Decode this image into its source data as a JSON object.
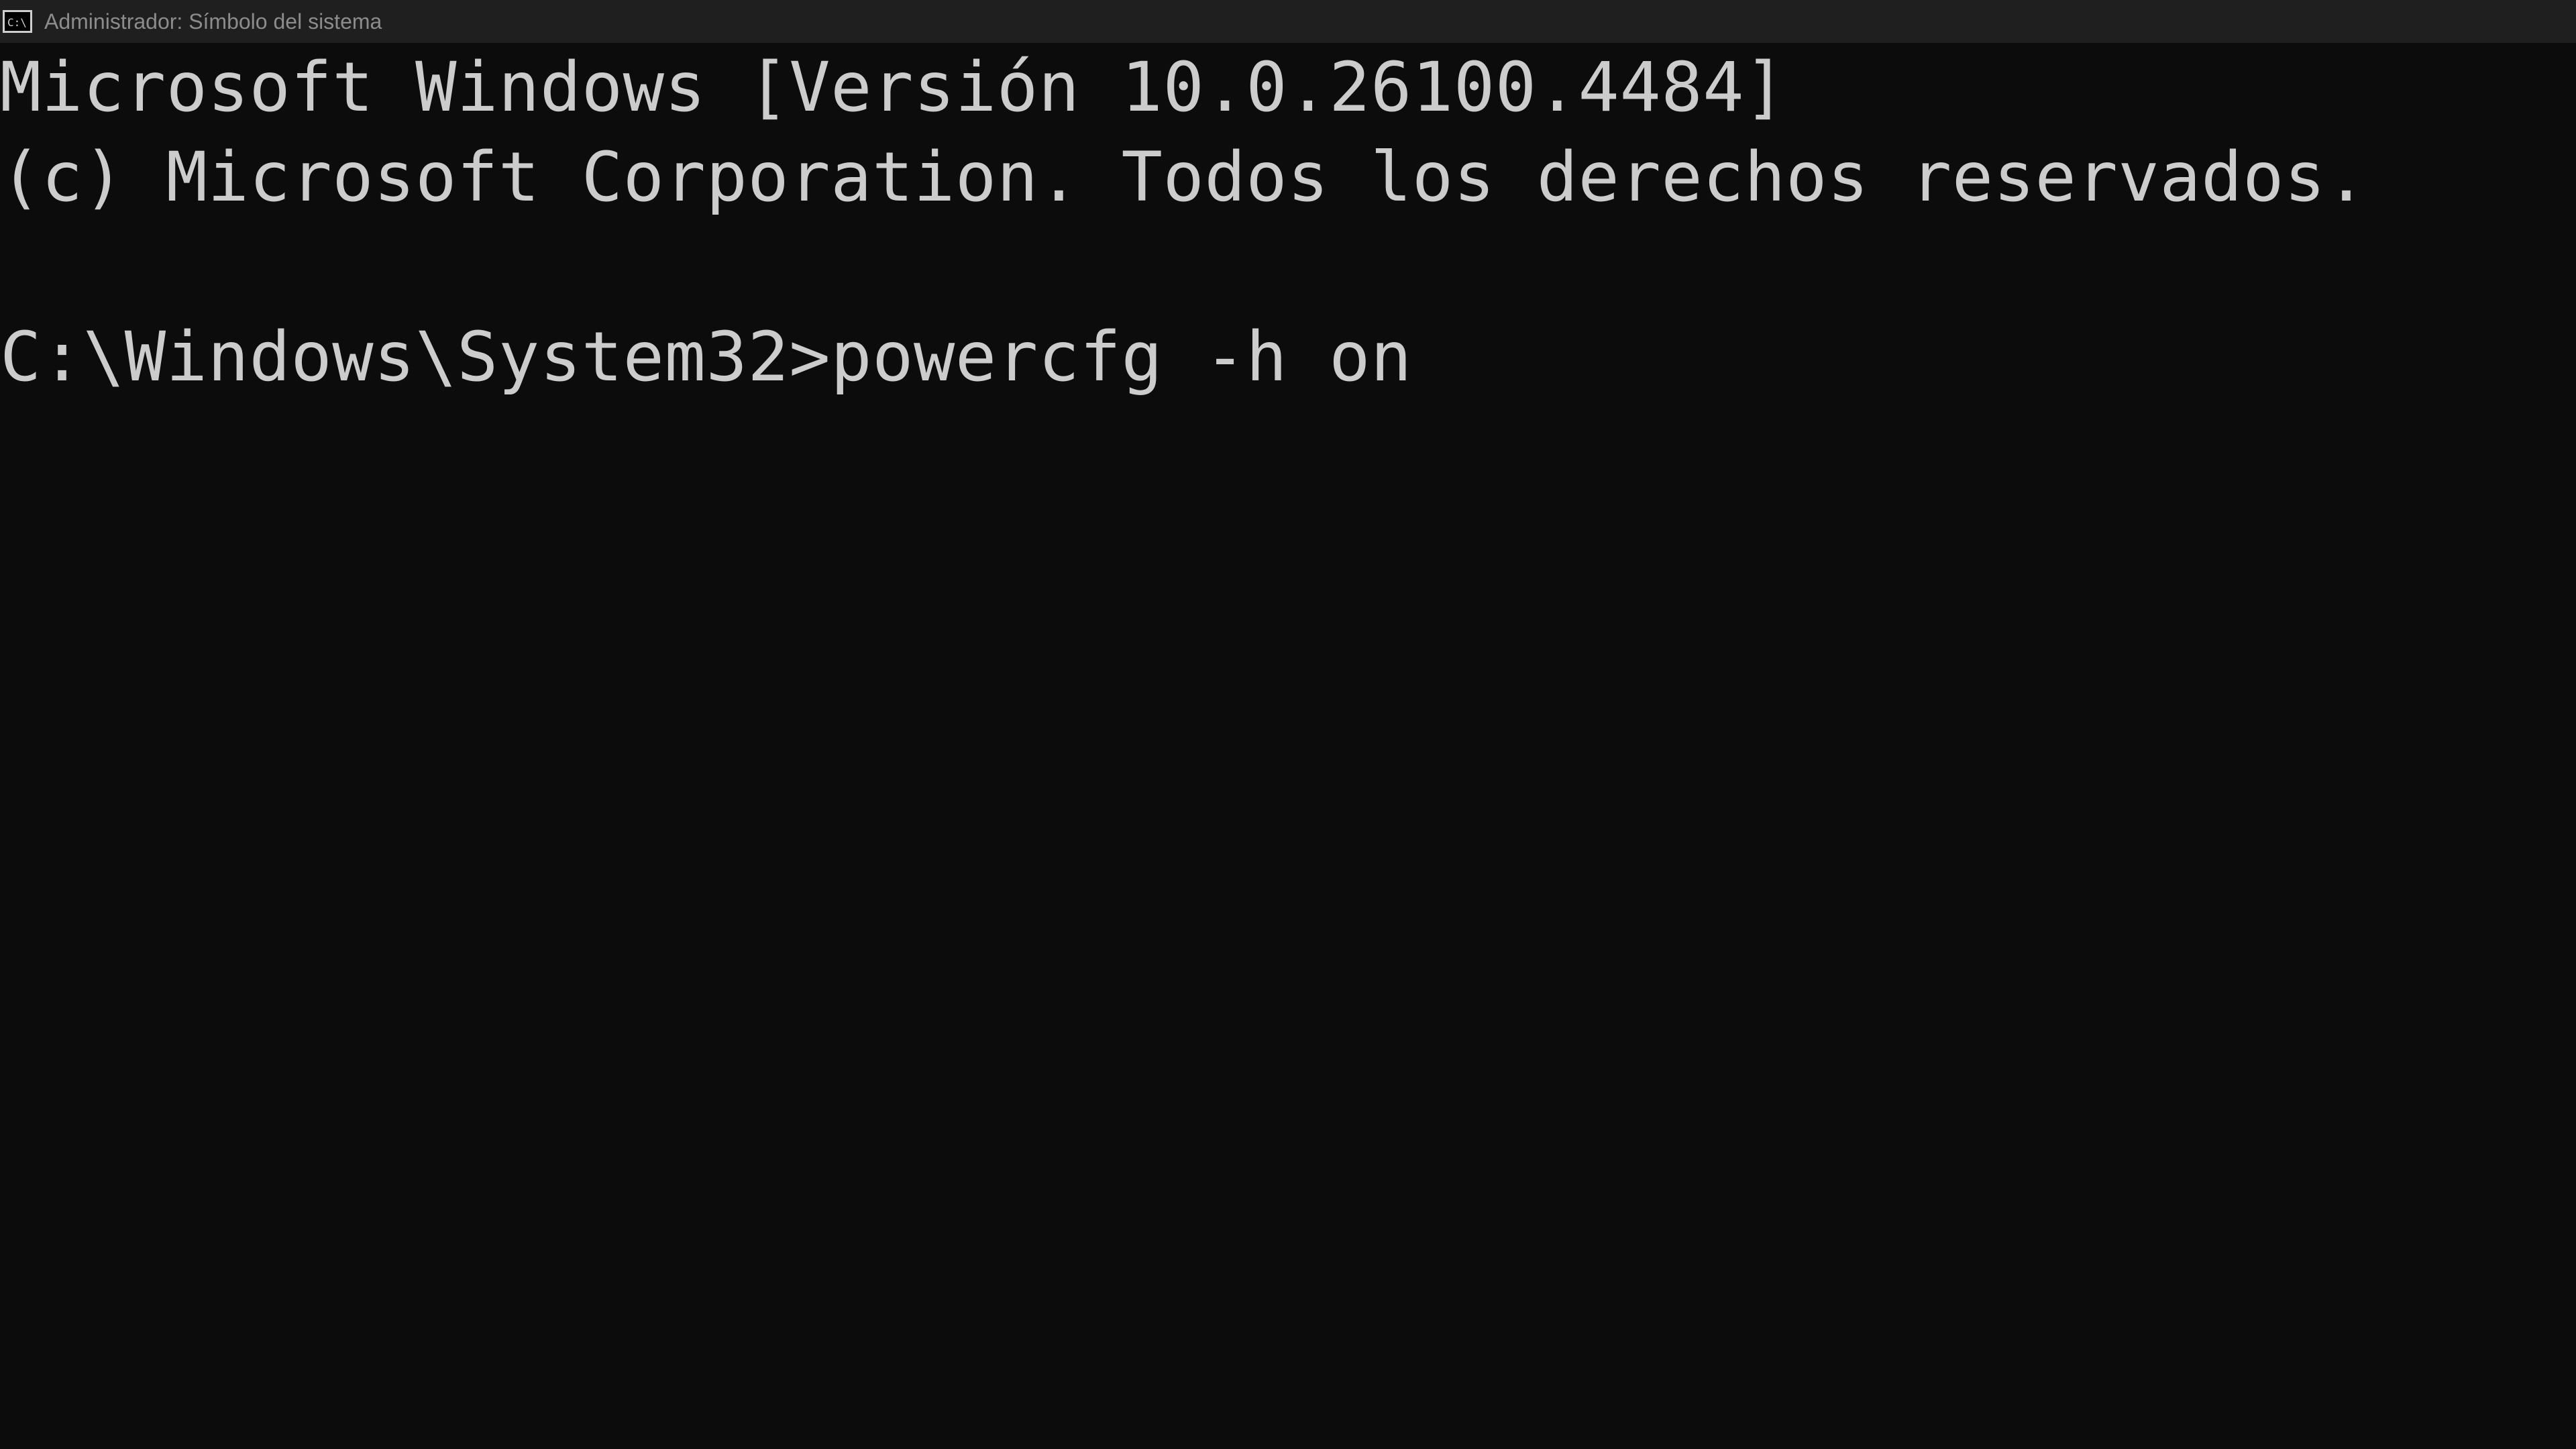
{
  "window": {
    "title": "Administrador: Símbolo del sistema",
    "icon": "cmd-console-icon"
  },
  "console": {
    "lines": [
      "Microsoft Windows [Versión 10.0.26100.4484]",
      "(c) Microsoft Corporation. Todos los derechos reservados.",
      "",
      "C:\\Windows\\System32>powercfg -h on"
    ],
    "prompt": "C:\\Windows\\System32>",
    "command": "powercfg -h on"
  },
  "colors": {
    "background": "#0c0c0c",
    "titlebar": "#1f1f1f",
    "text": "#cccccc",
    "title_text": "#8c8c8c"
  }
}
